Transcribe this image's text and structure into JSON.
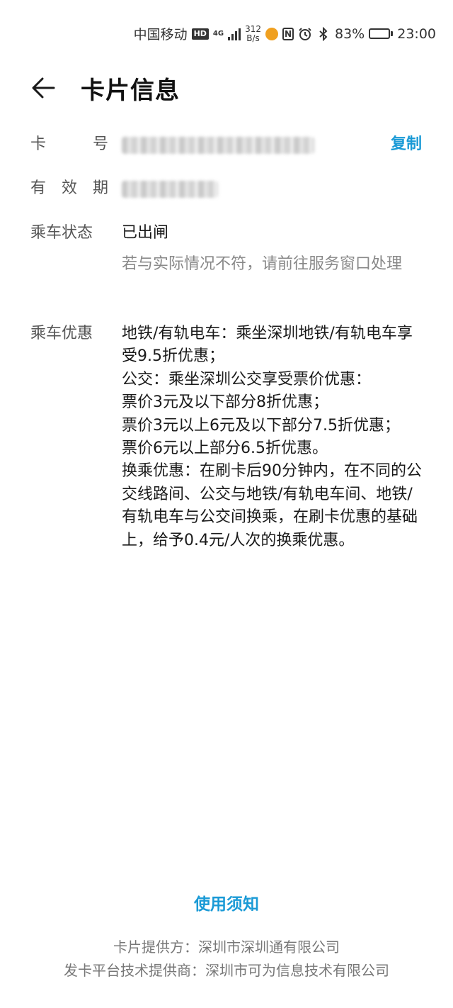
{
  "status_bar": {
    "carrier": "中国移动",
    "hd": "HD",
    "network": "4G",
    "speed_value": "312",
    "speed_unit": "B/s",
    "nfc": "N",
    "battery": "83%",
    "battery_level": 0.83,
    "time": "23:00",
    "icons": [
      "hd-icon",
      "signal-icon",
      "app-notification-icon",
      "nfc-icon",
      "alarm-icon",
      "bluetooth-icon",
      "battery-icon"
    ]
  },
  "header": {
    "title": "卡片信息",
    "back_icon": "back-arrow-icon"
  },
  "card": {
    "number_label": "卡 号",
    "number_label_chars": [
      "卡",
      "号"
    ],
    "copy_label": "复制",
    "validity_label_chars": [
      "有",
      "效",
      "期"
    ],
    "ride_status_label": "乘车状态",
    "ride_status_value": "已出闸",
    "ride_status_note": "若与实际情况不符，请前往服务窗口处理",
    "discount_label": "乘车优惠",
    "discount_text": "地铁/有轨电车：乘坐深圳地铁/有轨电车享受9.5折优惠；\n公交：乘坐深圳公交享受票价优惠：\n票价3元及以下部分8折优惠；\n票价3元以上6元及以下部分7.5折优惠；\n票价6元以上部分6.5折优惠。\n换乘优惠：在刷卡后90分钟内，在不同的公交线路间、公交与地铁/有轨电车间、地铁/有轨电车与公交间换乘，在刷卡优惠的基础上，给予0.4元/人次的换乘优惠。"
  },
  "footer": {
    "usage_link": "使用须知",
    "card_provider": "卡片提供方：深圳市深圳通有限公司",
    "platform_provider": "发卡平台技术提供商：深圳市可为信息技术有限公司"
  },
  "colors": {
    "accent": "#1a9ad6",
    "label": "#555555",
    "note": "#888888"
  }
}
